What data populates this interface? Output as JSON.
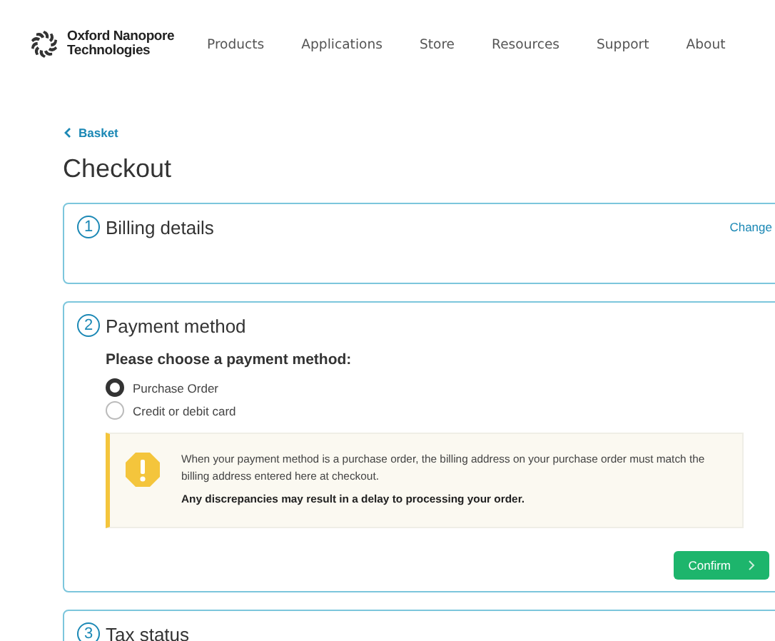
{
  "header": {
    "logo_text": "Oxford Nanopore Technologies",
    "nav": [
      "Products",
      "Applications",
      "Store",
      "Resources",
      "Support",
      "About"
    ]
  },
  "back_link": "Basket",
  "title": "Checkout",
  "steps": [
    {
      "kind": "collapsed",
      "number": "1",
      "title": "Billing details",
      "action": "Change"
    },
    {
      "kind": "payment",
      "number": "2",
      "title": "Payment method",
      "prompt": "Please choose a payment method:",
      "options": [
        {
          "label": "Purchase Order",
          "selected": true
        },
        {
          "label": "Credit or debit card",
          "selected": false
        }
      ],
      "notice": {
        "text": "When your payment method is a purchase order, the billing address on your purchase order must match the billing address entered here at checkout.",
        "emphasis": "Any discrepancies may result in a delay to processing your order."
      },
      "button": "Confirm"
    },
    {
      "kind": "header_only",
      "number": "3",
      "title": "Tax status"
    }
  ]
}
